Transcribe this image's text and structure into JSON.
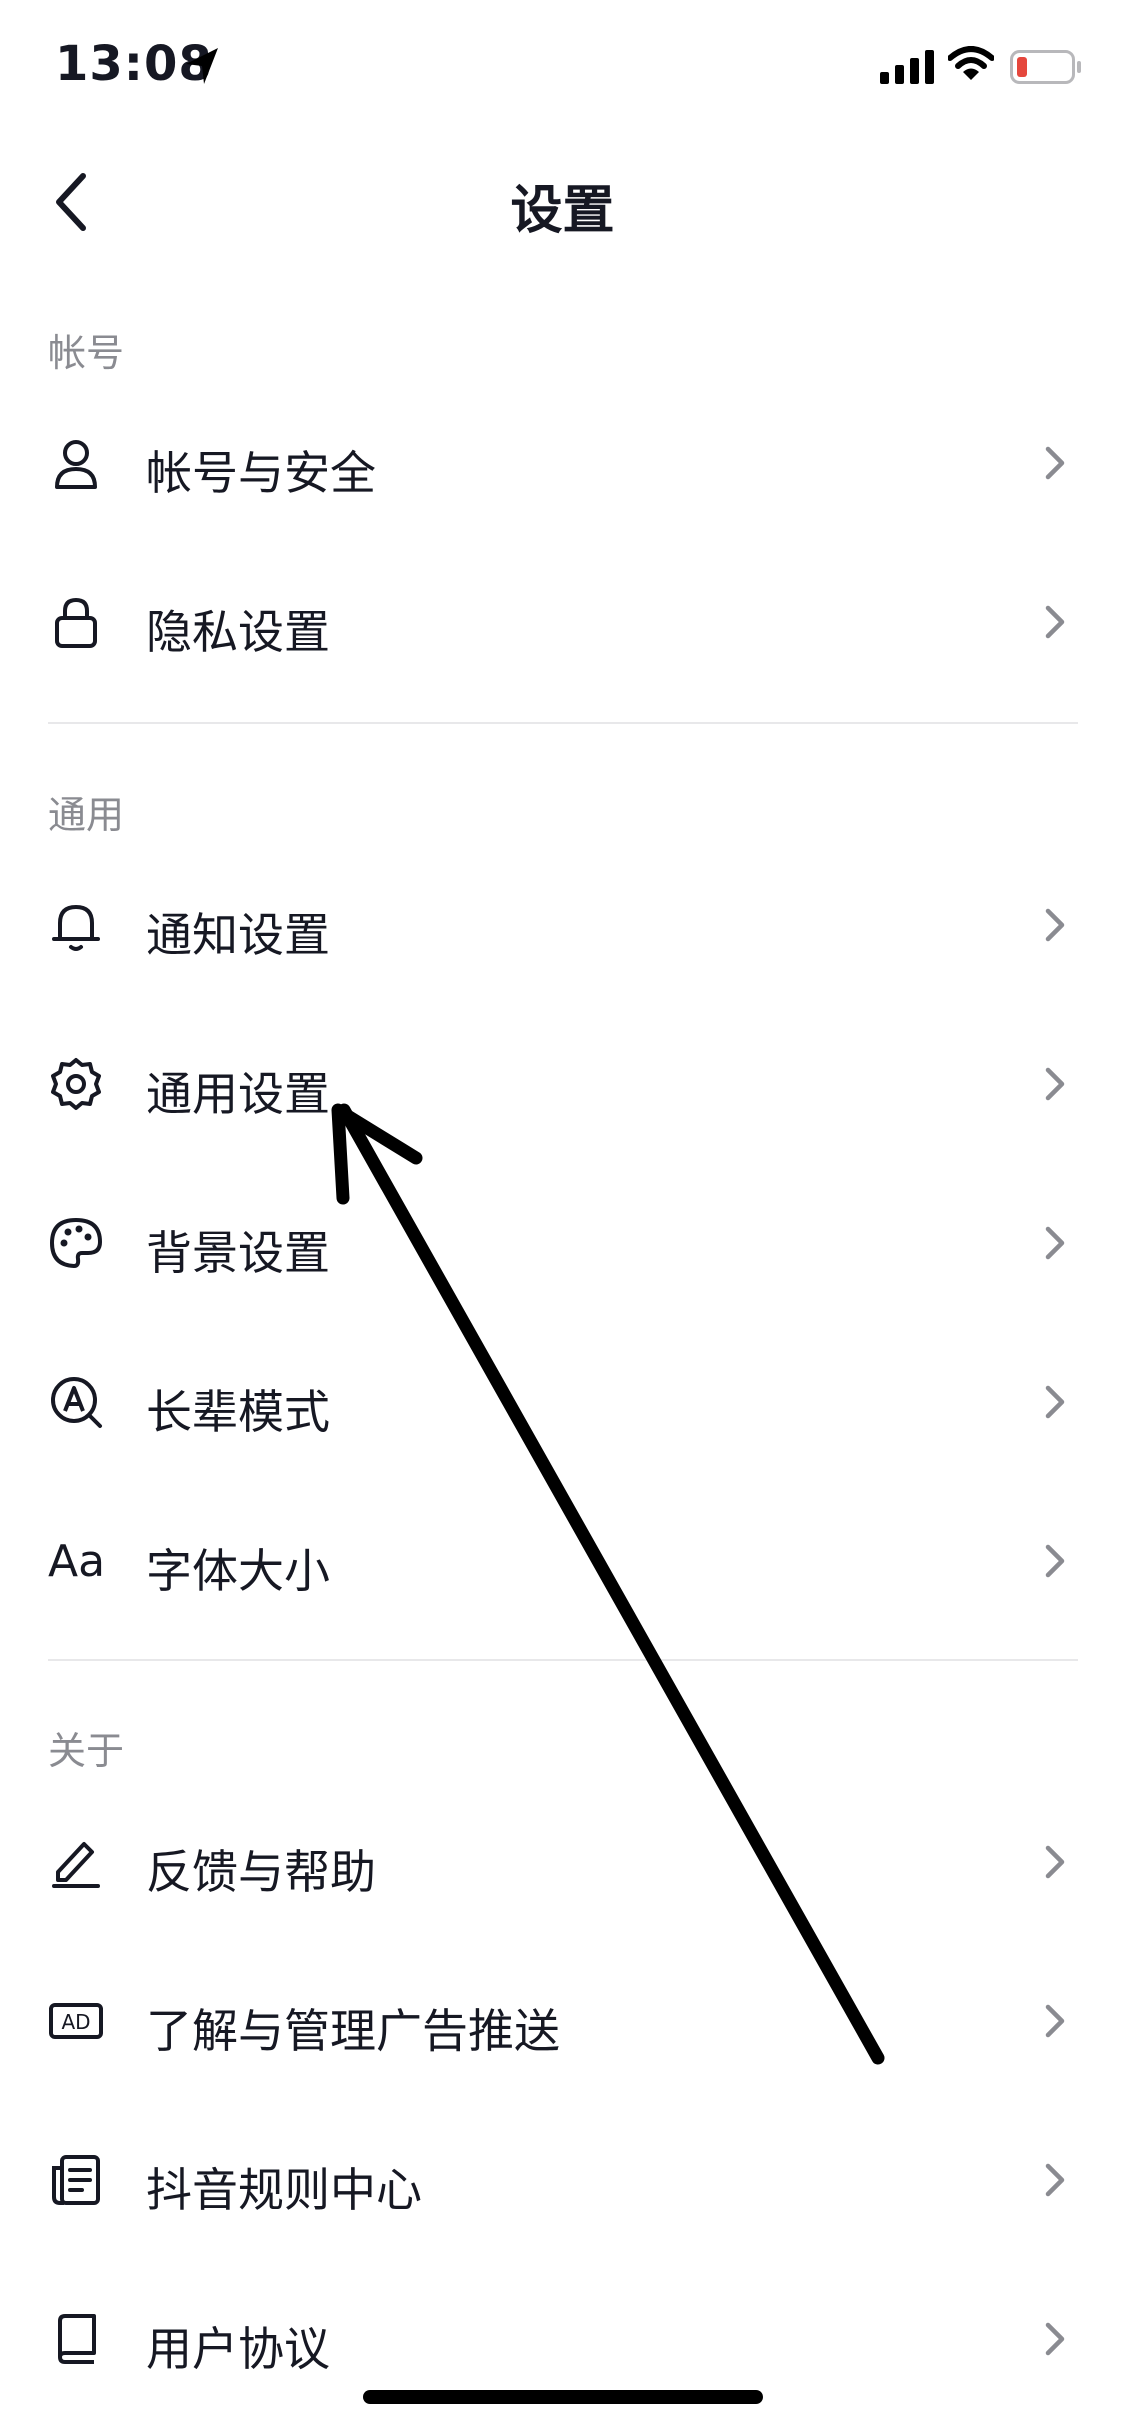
{
  "status_bar": {
    "time": "13:08",
    "icons": [
      "location-arrow-icon",
      "cellular-signal-icon",
      "wifi-icon",
      "battery-low-icon"
    ],
    "battery_color": "#e5473d"
  },
  "nav": {
    "title": "设置",
    "back_icon": "chevron-left-icon"
  },
  "sections": {
    "account": {
      "header": "帐号",
      "items": [
        {
          "label": "帐号与安全",
          "icon": "user-icon"
        },
        {
          "label": "隐私设置",
          "icon": "lock-icon"
        }
      ]
    },
    "general": {
      "header": "通用",
      "items": [
        {
          "label": "通知设置",
          "icon": "bell-icon"
        },
        {
          "label": "通用设置",
          "icon": "gear-icon"
        },
        {
          "label": "背景设置",
          "icon": "palette-icon"
        },
        {
          "label": "长辈模式",
          "icon": "elder-mode-icon"
        },
        {
          "label": "字体大小",
          "icon": "font-size-icon",
          "icon_text": "Aa"
        }
      ]
    },
    "about": {
      "header": "关于",
      "items": [
        {
          "label": "反馈与帮助",
          "icon": "pencil-icon"
        },
        {
          "label": "了解与管理广告推送",
          "icon": "ad-icon",
          "icon_text": "AD"
        },
        {
          "label": "抖音规则中心",
          "icon": "document-icon"
        },
        {
          "label": "用户协议",
          "icon": "book-icon"
        }
      ]
    }
  },
  "annotation": {
    "type": "arrow",
    "points_to": "通用设置",
    "color": "#000000"
  }
}
